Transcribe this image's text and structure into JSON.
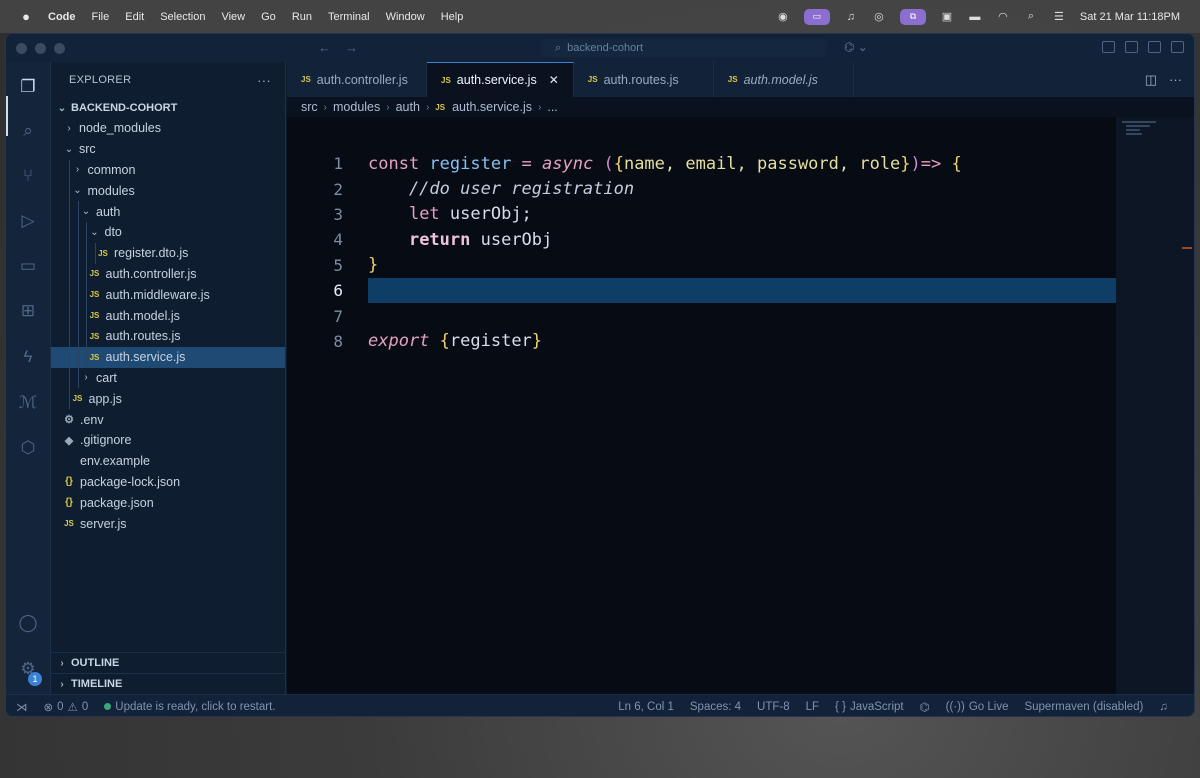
{
  "menubar": {
    "app": "Code",
    "items": [
      "File",
      "Edit",
      "Selection",
      "View",
      "Go",
      "Run",
      "Terminal",
      "Window",
      "Help"
    ],
    "datetime": "Sat 21 Mar  11:18PM"
  },
  "window": {
    "search_text": "backend-cohort"
  },
  "sidebar": {
    "title": "EXPLORER",
    "more": "···",
    "project": "BACKEND-COHORT",
    "tree": [
      {
        "label": "node_modules",
        "kind": "folder",
        "open": false,
        "depth": 0
      },
      {
        "label": "src",
        "kind": "folder",
        "open": true,
        "depth": 0
      },
      {
        "label": "common",
        "kind": "folder",
        "open": false,
        "depth": 1
      },
      {
        "label": "modules",
        "kind": "folder",
        "open": true,
        "depth": 1
      },
      {
        "label": "auth",
        "kind": "folder",
        "open": true,
        "depth": 2
      },
      {
        "label": "dto",
        "kind": "folder",
        "open": true,
        "depth": 3
      },
      {
        "label": "register.dto.js",
        "kind": "js",
        "depth": 4
      },
      {
        "label": "auth.controller.js",
        "kind": "js",
        "depth": 3
      },
      {
        "label": "auth.middleware.js",
        "kind": "js",
        "depth": 3
      },
      {
        "label": "auth.model.js",
        "kind": "js",
        "depth": 3
      },
      {
        "label": "auth.routes.js",
        "kind": "js",
        "depth": 3
      },
      {
        "label": "auth.service.js",
        "kind": "js",
        "depth": 3,
        "selected": true
      },
      {
        "label": "cart",
        "kind": "folder",
        "open": false,
        "depth": 2
      },
      {
        "label": "app.js",
        "kind": "js",
        "depth": 1
      },
      {
        "label": ".env",
        "kind": "env",
        "depth": 0
      },
      {
        "label": ".gitignore",
        "kind": "git",
        "depth": 0
      },
      {
        "label": "env.example",
        "kind": "plain",
        "depth": 0
      },
      {
        "label": "package-lock.json",
        "kind": "json",
        "depth": 0
      },
      {
        "label": "package.json",
        "kind": "json",
        "depth": 0
      },
      {
        "label": "server.js",
        "kind": "js",
        "depth": 0
      }
    ],
    "outline": "OUTLINE",
    "timeline": "TIMELINE"
  },
  "tabs": [
    {
      "label": "auth.controller.js",
      "active": false,
      "italic": false
    },
    {
      "label": "auth.service.js",
      "active": true,
      "italic": false
    },
    {
      "label": "auth.routes.js",
      "active": false,
      "italic": false
    },
    {
      "label": "auth.model.js",
      "active": false,
      "italic": true
    }
  ],
  "breadcrumb": [
    "src",
    "modules",
    "auth",
    "auth.service.js",
    "..."
  ],
  "file_badge": "JS",
  "code": {
    "current_line": 6,
    "lines": [
      [
        {
          "t": "const ",
          "c": "kw"
        },
        {
          "t": "register",
          "c": "var"
        },
        {
          "t": " = ",
          "c": "op"
        },
        {
          "t": "async",
          "c": "kw2"
        },
        {
          "t": " (",
          "c": "paren"
        },
        {
          "t": "{",
          "c": "brace"
        },
        {
          "t": "name, email, password, role",
          "c": "param"
        },
        {
          "t": "}",
          "c": "brace"
        },
        {
          "t": ")",
          "c": "paren"
        },
        {
          "t": "=>",
          "c": "op"
        },
        {
          "t": " {",
          "c": "brace"
        }
      ],
      [
        {
          "t": "    //do user registration",
          "c": "cmt"
        }
      ],
      [
        {
          "t": "    ",
          "c": "plain"
        },
        {
          "t": "let",
          "c": "kw"
        },
        {
          "t": " userObj;",
          "c": "plain"
        }
      ],
      [
        {
          "t": "    ",
          "c": "plain"
        },
        {
          "t": "return",
          "c": "ret"
        },
        {
          "t": " userObj",
          "c": "plain"
        }
      ],
      [
        {
          "t": "}",
          "c": "brace"
        }
      ],
      [],
      [],
      [
        {
          "t": "export",
          "c": "kw2"
        },
        {
          "t": " {",
          "c": "brace"
        },
        {
          "t": "register",
          "c": "plain"
        },
        {
          "t": "}",
          "c": "brace"
        }
      ]
    ]
  },
  "status": {
    "errors": "0",
    "warnings": "0",
    "update": "Update is ready, click to restart.",
    "position": "Ln 6, Col 1",
    "spaces": "Spaces: 4",
    "encoding": "UTF-8",
    "eol": "LF",
    "language": "JavaScript",
    "golive": "Go Live",
    "supermaven": "Supermaven (disabled)"
  },
  "activity_badge": "1"
}
